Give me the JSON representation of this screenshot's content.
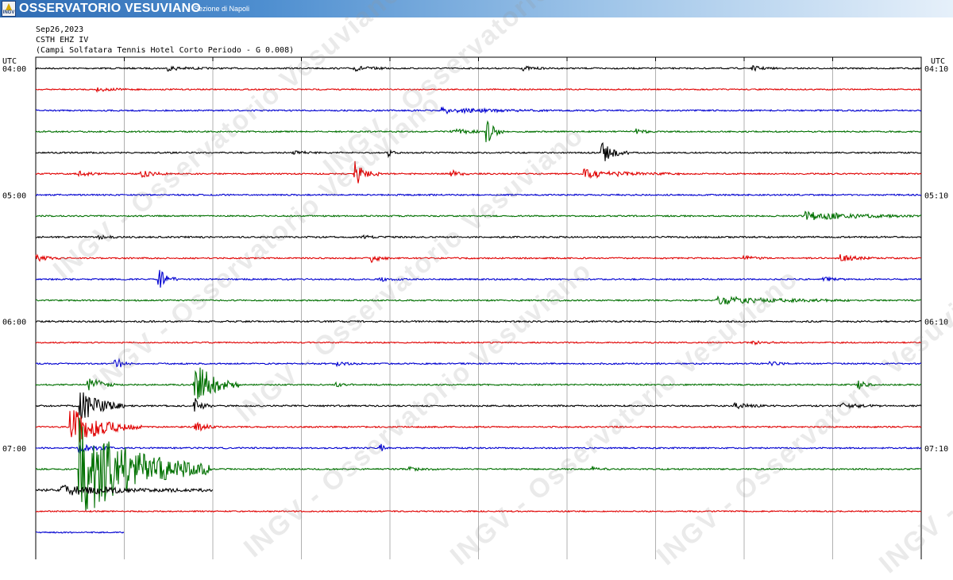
{
  "header": {
    "logo_text": "INGV",
    "brand": "OSSERVATORIO VESUVIANO",
    "section": "Sezione di Napoli"
  },
  "plot_header": {
    "date": "Sep26,2023",
    "channel": "CSTH EHZ IV",
    "station": "(Campi Solfatara Tennis Hotel Corto Periodo - G 0.008)"
  },
  "watermark": "INGV - Osservatorio Vesuviano",
  "chart_data": {
    "type": "line",
    "chart_kind": "helicorder seismogram",
    "timezone_label": "UTC",
    "minutes_per_line": 10,
    "minute_ticks": [
      0,
      1,
      2,
      3,
      4,
      5,
      6,
      7,
      8,
      9,
      10
    ],
    "left_hour_labels": [
      {
        "line": 0,
        "text": "04:00"
      },
      {
        "line": 6,
        "text": "05:00"
      },
      {
        "line": 12,
        "text": "06:00"
      },
      {
        "line": 18,
        "text": "07:00"
      }
    ],
    "right_hour_labels": [
      {
        "line": 0,
        "text": "04:10"
      },
      {
        "line": 6,
        "text": "05:10"
      },
      {
        "line": 12,
        "text": "06:10"
      },
      {
        "line": 18,
        "text": "07:10"
      }
    ],
    "trace_colors": [
      "#000000",
      "#e00000",
      "#0000d0",
      "#007000"
    ],
    "traces": [
      {
        "line": 0,
        "end_minute": 10,
        "noise": 0.9,
        "bursts": [
          {
            "t": 1.5,
            "dur": 0.5,
            "amp": 2.5
          },
          {
            "t": 3.6,
            "dur": 0.4,
            "amp": 3
          },
          {
            "t": 5.5,
            "dur": 0.3,
            "amp": 2.5
          },
          {
            "t": 8.1,
            "dur": 0.3,
            "amp": 2.5
          }
        ]
      },
      {
        "line": 1,
        "end_minute": 10,
        "noise": 0.8,
        "bursts": [
          {
            "t": 0.7,
            "dur": 0.5,
            "amp": 2
          }
        ]
      },
      {
        "line": 2,
        "end_minute": 10,
        "noise": 0.9,
        "bursts": [
          {
            "t": 4.6,
            "dur": 1.2,
            "amp": 3.5
          }
        ]
      },
      {
        "line": 3,
        "end_minute": 10,
        "noise": 0.9,
        "bursts": [
          {
            "t": 4.7,
            "dur": 0.4,
            "amp": 4
          },
          {
            "t": 5.1,
            "dur": 0.2,
            "amp": 14
          },
          {
            "t": 6.8,
            "dur": 0.2,
            "amp": 3
          }
        ]
      },
      {
        "line": 4,
        "end_minute": 10,
        "noise": 0.9,
        "bursts": [
          {
            "t": 2.9,
            "dur": 0.4,
            "amp": 2
          },
          {
            "t": 4.0,
            "dur": 0.1,
            "amp": 4
          },
          {
            "t": 6.4,
            "dur": 0.3,
            "amp": 14
          }
        ]
      },
      {
        "line": 5,
        "end_minute": 10,
        "noise": 0.9,
        "bursts": [
          {
            "t": 0.5,
            "dur": 0.3,
            "amp": 3
          },
          {
            "t": 1.2,
            "dur": 0.3,
            "amp": 5
          },
          {
            "t": 3.6,
            "dur": 0.3,
            "amp": 16
          },
          {
            "t": 4.7,
            "dur": 0.2,
            "amp": 5
          },
          {
            "t": 6.2,
            "dur": 1.1,
            "amp": 5
          }
        ]
      },
      {
        "line": 6,
        "end_minute": 10,
        "noise": 0.9,
        "bursts": []
      },
      {
        "line": 7,
        "end_minute": 10,
        "noise": 0.9,
        "bursts": [
          {
            "t": 8.7,
            "dur": 1.4,
            "amp": 5
          }
        ]
      },
      {
        "line": 8,
        "end_minute": 10,
        "noise": 1,
        "bursts": [
          {
            "t": 0.7,
            "dur": 0.3,
            "amp": 2
          },
          {
            "t": 3.7,
            "dur": 0.3,
            "amp": 2
          }
        ]
      },
      {
        "line": 9,
        "end_minute": 10,
        "noise": 0.9,
        "bursts": [
          {
            "t": 0.0,
            "dur": 0.3,
            "amp": 4
          },
          {
            "t": 3.8,
            "dur": 0.2,
            "amp": 5
          },
          {
            "t": 8.0,
            "dur": 0.3,
            "amp": 2.5
          },
          {
            "t": 9.1,
            "dur": 0.4,
            "amp": 4
          }
        ]
      },
      {
        "line": 10,
        "end_minute": 10,
        "noise": 0.9,
        "bursts": [
          {
            "t": 1.4,
            "dur": 0.2,
            "amp": 12
          },
          {
            "t": 3.9,
            "dur": 0.3,
            "amp": 2
          },
          {
            "t": 8.9,
            "dur": 0.4,
            "amp": 2
          }
        ]
      },
      {
        "line": 11,
        "end_minute": 10,
        "noise": 0.9,
        "bursts": [
          {
            "t": 7.7,
            "dur": 1.5,
            "amp": 5
          }
        ]
      },
      {
        "line": 12,
        "end_minute": 10,
        "noise": 1,
        "bursts": []
      },
      {
        "line": 13,
        "end_minute": 10,
        "noise": 0.8,
        "bursts": [
          {
            "t": 8.1,
            "dur": 0.3,
            "amp": 2
          }
        ]
      },
      {
        "line": 14,
        "end_minute": 10,
        "noise": 0.9,
        "bursts": [
          {
            "t": 0.9,
            "dur": 0.2,
            "amp": 8
          },
          {
            "t": 3.4,
            "dur": 0.3,
            "amp": 2
          },
          {
            "t": 8.3,
            "dur": 0.3,
            "amp": 2
          }
        ]
      },
      {
        "line": 15,
        "end_minute": 10,
        "noise": 0.9,
        "bursts": [
          {
            "t": 0.6,
            "dur": 0.3,
            "amp": 12
          },
          {
            "t": 1.8,
            "dur": 0.5,
            "amp": 30
          },
          {
            "t": 3.4,
            "dur": 0.2,
            "amp": 2
          },
          {
            "t": 9.3,
            "dur": 0.2,
            "amp": 5
          }
        ]
      },
      {
        "line": 16,
        "end_minute": 10,
        "noise": 1,
        "bursts": [
          {
            "t": 0.5,
            "dur": 0.5,
            "amp": 22
          },
          {
            "t": 1.8,
            "dur": 0.2,
            "amp": 10
          },
          {
            "t": 7.9,
            "dur": 0.4,
            "amp": 3
          },
          {
            "t": 9.1,
            "dur": 0.5,
            "amp": 3
          }
        ]
      },
      {
        "line": 17,
        "end_minute": 10,
        "noise": 0.9,
        "bursts": [
          {
            "t": 0.4,
            "dur": 0.8,
            "amp": 25
          },
          {
            "t": 1.8,
            "dur": 0.3,
            "amp": 6
          }
        ]
      },
      {
        "line": 18,
        "end_minute": 10,
        "noise": 0.9,
        "bursts": [
          {
            "t": 0.5,
            "dur": 0.4,
            "amp": 6
          },
          {
            "t": 3.9,
            "dur": 0.1,
            "amp": 5
          }
        ]
      },
      {
        "line": 19,
        "end_minute": 10,
        "noise": 0.9,
        "bursts": [
          {
            "t": 0.5,
            "dur": 1.5,
            "amp": 65
          },
          {
            "t": 4.2,
            "dur": 0.4,
            "amp": 2.5
          },
          {
            "t": 6.3,
            "dur": 0.2,
            "amp": 3
          }
        ]
      },
      {
        "line": 20,
        "end_minute": 2.0,
        "noise": 1.4,
        "bursts": [
          {
            "t": 0.3,
            "dur": 1.6,
            "amp": 6
          }
        ]
      },
      {
        "line": 21,
        "end_minute": 10,
        "noise": 0.8,
        "bursts": []
      },
      {
        "line": 22,
        "end_minute": 1.0,
        "noise": 0.8,
        "bursts": []
      }
    ]
  }
}
